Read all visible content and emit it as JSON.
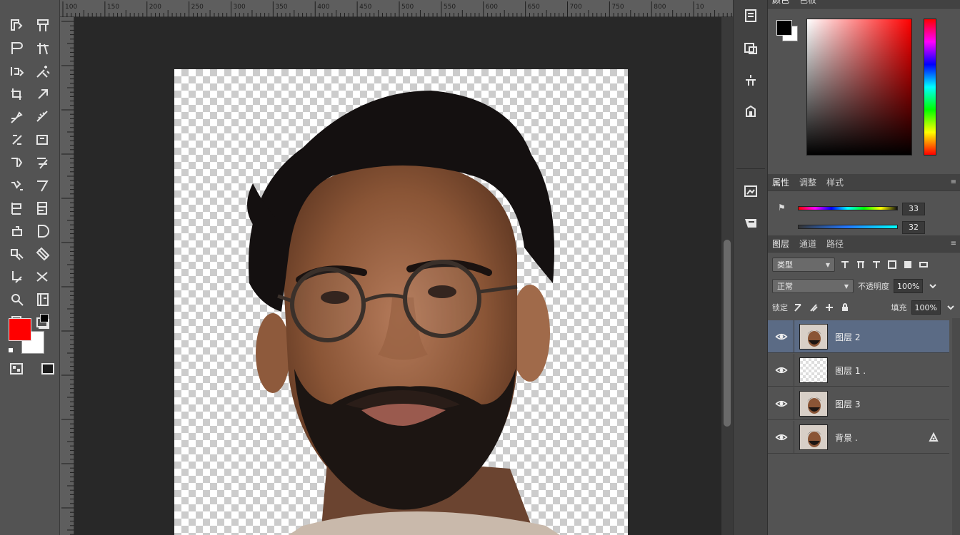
{
  "toolbar": {
    "tools": [
      "move-tool",
      "artboard-tool",
      "marquee-tool",
      "lasso-tool",
      "quick-select-tool",
      "magic-wand-tool",
      "crop-tool",
      "slice-tool",
      "eyedropper-tool",
      "ruler-tool",
      "healing-brush-tool",
      "patch-tool",
      "brush-tool",
      "pencil-tool",
      "clone-stamp-tool",
      "pattern-stamp-tool",
      "history-brush-tool",
      "art-history-tool",
      "eraser-tool",
      "background-eraser-tool",
      "gradient-tool",
      "paint-bucket-tool",
      "blur-tool",
      "dodge-tool",
      "pen-tool",
      "type-tool",
      "path-select-tool",
      "shape-tool"
    ],
    "foreground_color": "#ff0000",
    "background_color": "#ffffff"
  },
  "rulers": {
    "top_labels": [
      "100",
      "150",
      "200",
      "250",
      "300",
      "350",
      "400",
      "450",
      "500",
      "550",
      "600",
      "650",
      "700",
      "750",
      "800",
      "10"
    ]
  },
  "color_panel": {
    "tabs": [
      "颜色",
      "色板"
    ],
    "foreground": "#000000",
    "background": "#ffffff",
    "hue_color": "#ff0000"
  },
  "adjust_panel": {
    "tabs": [
      "属性",
      "调整",
      "样式"
    ],
    "slider_1_value": "33",
    "slider_2_value": "32"
  },
  "layers_panel": {
    "tabs": [
      "图层",
      "通道",
      "路径"
    ],
    "filter_kind": "类型",
    "blend_mode": "正常",
    "opacity_label": "不透明度",
    "opacity_value": "100%",
    "lock_label": "锁定",
    "fill_label": "填充",
    "fill_value": "100%",
    "layers": [
      {
        "name": "图层 2",
        "selected": true,
        "thumb": "portrait"
      },
      {
        "name": "图层 1 .",
        "selected": false,
        "thumb": "transparent"
      },
      {
        "name": "图层 3",
        "selected": false,
        "thumb": "portrait"
      },
      {
        "name": "背景 .",
        "selected": false,
        "thumb": "portrait",
        "locked": true
      }
    ]
  }
}
